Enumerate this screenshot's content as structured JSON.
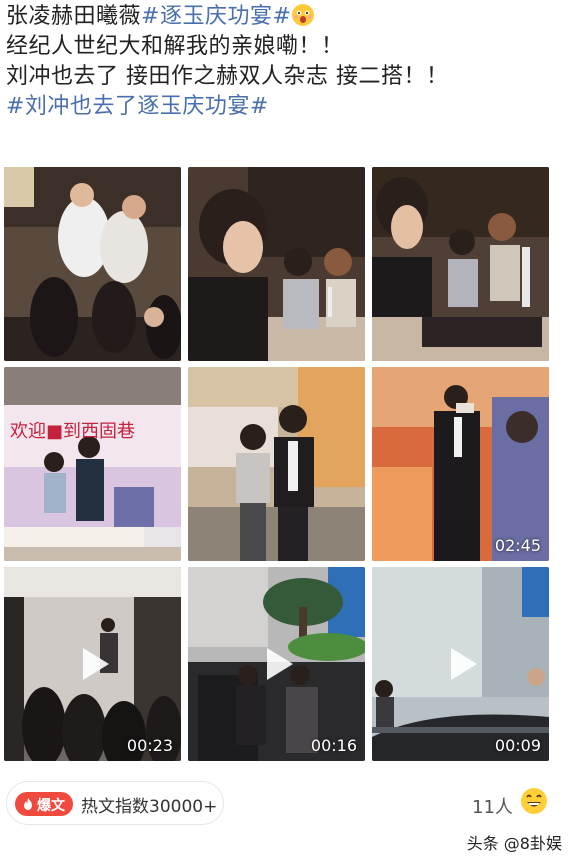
{
  "post": {
    "line1_prefix": "张凌赫田曦薇",
    "line1_hashtag": "#逐玉庆功宴#",
    "line2": "经纪人世纪大和解我的亲娘嘞！！",
    "line3": "刘冲也去了 接田作之赫双人杂志 接二搭！！",
    "line4_hashtag": "#刘冲也去了逐玉庆功宴#",
    "emoji": "excited-face-emoji"
  },
  "grid": {
    "tiles": [
      {
        "kind": "photo",
        "scene": "banquet-toast"
      },
      {
        "kind": "photo",
        "scene": "banquet-table-profile"
      },
      {
        "kind": "photo",
        "scene": "banquet-table-wide"
      },
      {
        "kind": "photo",
        "scene": "cake-stage-banner",
        "banner_text": "欢迎■到西固巷"
      },
      {
        "kind": "photo",
        "scene": "event-pair-standing"
      },
      {
        "kind": "video",
        "scene": "speech-stage",
        "duration": "02:45"
      },
      {
        "kind": "video",
        "scene": "night-crowd",
        "duration": "00:23"
      },
      {
        "kind": "video",
        "scene": "car-arrival",
        "duration": "00:16"
      },
      {
        "kind": "video",
        "scene": "car-window",
        "duration": "00:09"
      }
    ]
  },
  "footer": {
    "hot_badge": "爆文",
    "hot_label": "热文指数30000+",
    "likes": "11人",
    "likes_emoji": "grinning-face-emoji"
  },
  "watermark": "头条 @8卦娱",
  "colors": {
    "hashtag": "#4a6fae",
    "hot_badge_bg": "#f04a3e"
  }
}
